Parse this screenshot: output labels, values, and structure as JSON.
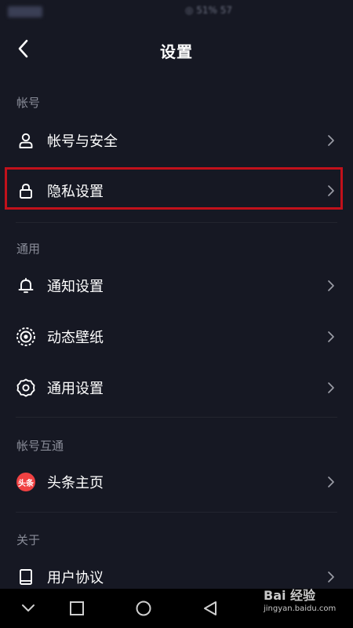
{
  "status_bar": {
    "right_text": "◎ 51% 57"
  },
  "header": {
    "title": "设置"
  },
  "sections": [
    {
      "label": "帐号"
    },
    {
      "label": "通用"
    },
    {
      "label": "帐号互通"
    },
    {
      "label": "关于"
    }
  ],
  "items": [
    {
      "label": "帐号与安全",
      "icon": "user-icon"
    },
    {
      "label": "隐私设置",
      "icon": "lock-icon"
    },
    {
      "label": "通知设置",
      "icon": "bell-icon"
    },
    {
      "label": "动态壁纸",
      "icon": "wallpaper-icon"
    },
    {
      "label": "通用设置",
      "icon": "gear-icon"
    },
    {
      "label": "头条主页",
      "icon": "toutiao-icon",
      "badge": "头条"
    },
    {
      "label": "用户协议",
      "icon": "book-icon"
    }
  ],
  "watermark": {
    "brand": "Bai 经验",
    "url": "jingyan.baidu.com"
  },
  "colors": {
    "background": "#161823",
    "highlight": "#c1111b",
    "secondary_text": "#8a8d99",
    "toutiao_red": "#f04142"
  }
}
